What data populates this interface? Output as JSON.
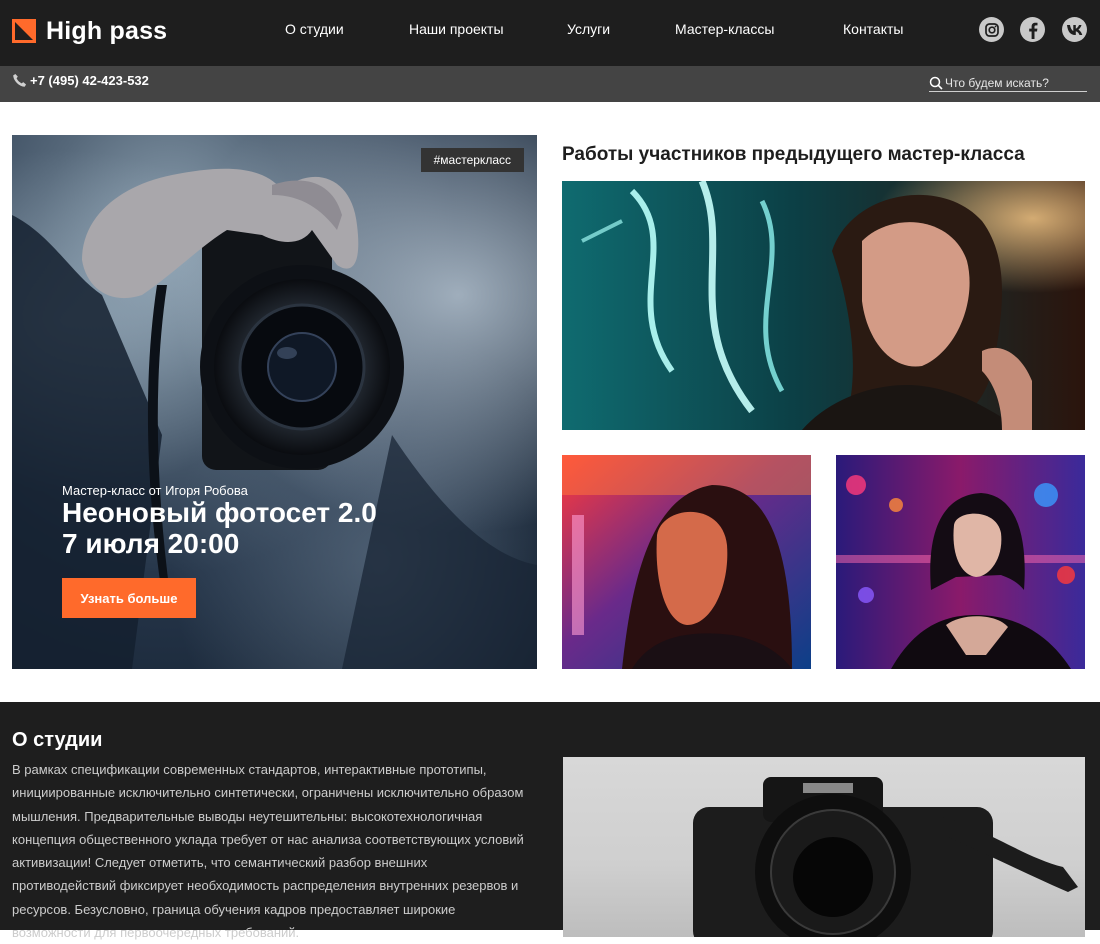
{
  "brand": {
    "name": "High pass",
    "accent": "#ff6a2b",
    "header_bg": "#1e1e1e",
    "subbar_bg": "#444444"
  },
  "nav": [
    {
      "label": "О студии"
    },
    {
      "label": "Наши проекты"
    },
    {
      "label": "Услуги"
    },
    {
      "label": "Мастер-классы"
    },
    {
      "label": "Контакты"
    }
  ],
  "social": [
    "instagram-icon",
    "facebook-icon",
    "vk-icon"
  ],
  "contact": {
    "phone": "+7 (495) 42-423-532"
  },
  "search": {
    "placeholder": "Что будем искать?",
    "value": ""
  },
  "hero": {
    "tag": "#мастеркласс",
    "subtitle": "Мастер-класс от Игоря Робова",
    "title_line1": "Неоновый фотосет 2.0",
    "title_line2": "7 июля 20:00",
    "button": "Узнать больше"
  },
  "works": {
    "title": "Работы участников предыдущего мастер-класса"
  },
  "about": {
    "title": "О студии",
    "text": "В рамках спецификации современных стандартов, интерактивные прототипы, инициированные исключительно синтетически, ограничены исключительно образом мышления. Предварительные выводы неутешительны: высокотехнологичная концепция общественного уклада требует от нас анализа соответствующих условий активизации! Следует отметить, что семантический разбор внешних противодействий  фиксирует необходимость распределения внутренних резервов и ресурсов. Безусловно, граница обучения кадров предоставляет широкие возможности для первоочередных требований."
  }
}
